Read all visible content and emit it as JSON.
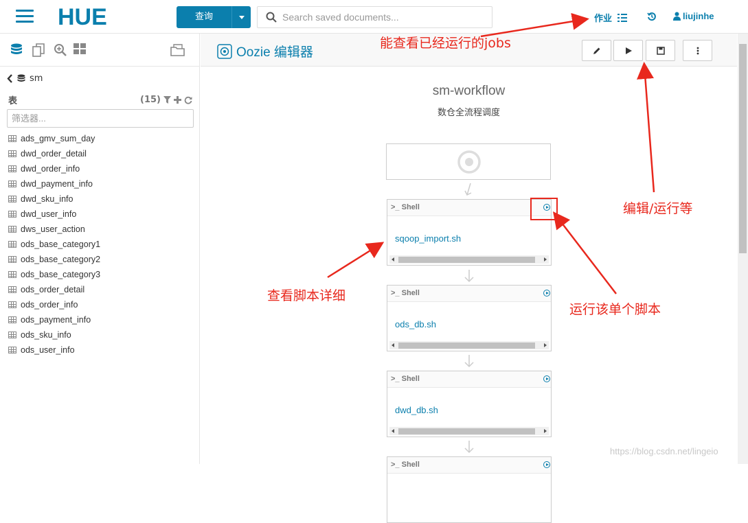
{
  "topbar": {
    "logo_text": "HUE",
    "query_label": "查询",
    "search_placeholder": "Search saved documents...",
    "jobs_label": "作业",
    "user_name": "liujinhe"
  },
  "left_panel": {
    "database": "sm",
    "tables_label": "表",
    "tables_count": "(15)",
    "filter_placeholder": "筛选器...",
    "tables": [
      "ads_gmv_sum_day",
      "dwd_order_detail",
      "dwd_order_info",
      "dwd_payment_info",
      "dwd_sku_info",
      "dwd_user_info",
      "dws_user_action",
      "ods_base_category1",
      "ods_base_category2",
      "ods_base_category3",
      "ods_order_detail",
      "ods_order_info",
      "ods_payment_info",
      "ods_sku_info",
      "ods_user_info"
    ]
  },
  "editor": {
    "title": "Oozie 编辑器",
    "workflow_name": "sm-workflow",
    "workflow_desc": "数仓全流程调度",
    "nodes": [
      {
        "type": "Shell",
        "script": "sqoop_import.sh"
      },
      {
        "type": "Shell",
        "script": "ods_db.sh"
      },
      {
        "type": "Shell",
        "script": "dwd_db.sh"
      },
      {
        "type": "Shell",
        "script": ""
      }
    ]
  },
  "annotations": {
    "jobs_note": "能查看已经运行的jobs",
    "edit_run_note": "编辑/运行等",
    "view_script_note": "查看脚本详细",
    "run_single_note": "运行该单个脚本"
  },
  "watermark": "https://blog.csdn.net/lingeio",
  "colors": {
    "accent": "#0B7FAD",
    "annotation": "#e8281d"
  }
}
